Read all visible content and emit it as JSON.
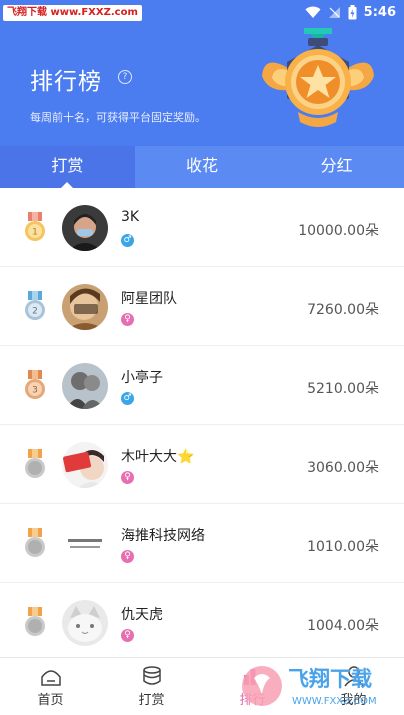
{
  "status_bar": {
    "watermark": "飞翔下载 www.FXXZ.com",
    "time": "5:46"
  },
  "header": {
    "title": "排行榜",
    "subtitle": "每周前十名，可获得平台固定奖励。",
    "accent_color": "#4b7cf0"
  },
  "tabs": [
    {
      "label": "打赏",
      "active": true
    },
    {
      "label": "收花",
      "active": false
    },
    {
      "label": "分红",
      "active": false
    }
  ],
  "ranking": [
    {
      "rank": "1",
      "name": "3K",
      "gender": "male",
      "amount": "10000.00朵"
    },
    {
      "rank": "2",
      "name": "阿星团队",
      "gender": "female",
      "amount": "7260.00朵"
    },
    {
      "rank": "3",
      "name": "小亭子",
      "gender": "male",
      "amount": "5210.00朵"
    },
    {
      "rank": "",
      "name": "木叶大大⭐",
      "gender": "female",
      "amount": "3060.00朵"
    },
    {
      "rank": "",
      "name": "海推科技网络",
      "gender": "female",
      "amount": "1010.00朵"
    },
    {
      "rank": "",
      "name": "仇天虎",
      "gender": "female",
      "amount": "1004.00朵"
    }
  ],
  "bottom_nav": [
    {
      "label": "首页",
      "icon": "home-icon",
      "active": false
    },
    {
      "label": "打赏",
      "icon": "coins-icon",
      "active": false
    },
    {
      "label": "排行",
      "icon": "ranking-icon",
      "active": true
    },
    {
      "label": "我的",
      "icon": "user-icon",
      "active": false
    }
  ],
  "brand_watermark": {
    "text": "飞翔下载",
    "url": "WWW.FXXZ.COM"
  }
}
